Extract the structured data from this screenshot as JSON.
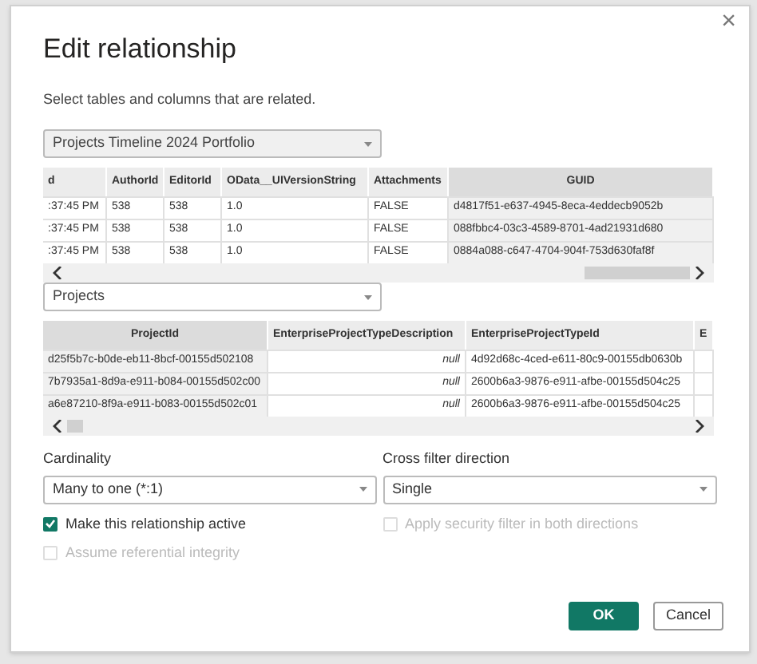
{
  "dialog": {
    "title": "Edit relationship",
    "subtitle": "Select tables and columns that are related.",
    "close": "×"
  },
  "tables": [
    {
      "selector": "Projects Timeline 2024 Portfolio",
      "columns": [
        {
          "label": "d",
          "selected": false,
          "kind": "plain"
        },
        {
          "label": "AuthorId",
          "selected": false,
          "kind": "plain"
        },
        {
          "label": "EditorId",
          "selected": false,
          "kind": "plain"
        },
        {
          "label": "OData__UIVersionString",
          "selected": false,
          "kind": "plain"
        },
        {
          "label": "Attachments",
          "selected": false,
          "kind": "plain"
        },
        {
          "label": "GUID",
          "selected": true,
          "kind": "plain"
        }
      ],
      "rows": [
        [
          ":37:45 PM",
          "538",
          "538",
          "1.0",
          "FALSE",
          "d4817f51-e637-4945-8eca-4eddecb9052b"
        ],
        [
          ":37:45 PM",
          "538",
          "538",
          "1.0",
          "FALSE",
          "088fbbc4-03c3-4589-8701-4ad21931d680"
        ],
        [
          ":37:45 PM",
          "538",
          "538",
          "1.0",
          "FALSE",
          "0884a088-c647-4704-904f-753d630faf8f"
        ]
      ]
    },
    {
      "selector": "Projects",
      "columns": [
        {
          "label": "ProjectId",
          "selected": true,
          "kind": "plain"
        },
        {
          "label": "EnterpriseProjectTypeDescription",
          "selected": false,
          "kind": "nullable"
        },
        {
          "label": "EnterpriseProjectTypeId",
          "selected": false,
          "kind": "plain"
        },
        {
          "label": "E",
          "selected": false,
          "kind": "plain"
        }
      ],
      "rows": [
        [
          "d25f5b7c-b0de-eb11-8bcf-00155d502108",
          "null",
          "4d92d68c-4ced-e611-80c9-00155db0630b",
          ""
        ],
        [
          "7b7935a1-8d9a-e911-b084-00155d502c00",
          "null",
          "2600b6a3-9876-e911-afbe-00155d504c25",
          ""
        ],
        [
          "a6e87210-8f9a-e911-b083-00155d502c01",
          "null",
          "2600b6a3-9876-e911-afbe-00155d504c25",
          ""
        ]
      ]
    }
  ],
  "cardinality": {
    "label": "Cardinality",
    "value": "Many to one (*:1)"
  },
  "cross_filter": {
    "label": "Cross filter direction",
    "value": "Single"
  },
  "options": [
    {
      "label": "Make this relationship active",
      "checked": true,
      "disabled": false
    },
    {
      "label": "Assume referential integrity",
      "checked": false,
      "disabled": true
    },
    {
      "label": "Apply security filter in both directions",
      "checked": false,
      "disabled": true
    }
  ],
  "buttons": [
    {
      "label": "OK",
      "kind": "primary"
    },
    {
      "label": "Cancel",
      "kind": "secondary"
    }
  ]
}
